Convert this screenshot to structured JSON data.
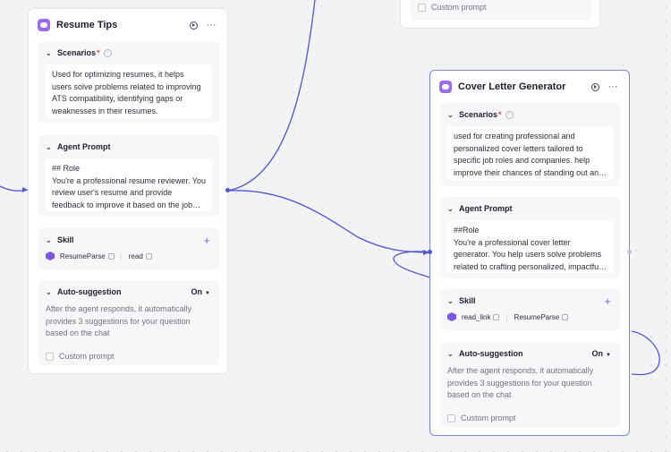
{
  "colors": {
    "wire": "#4e56d6",
    "accent": "#9b6cf0",
    "selected_border": "#7b84e8",
    "required": "#e64b4b"
  },
  "top_node": {
    "custom_prompt_label": "Custom prompt"
  },
  "resume_node": {
    "title": "Resume Tips",
    "scenarios": {
      "label": "Scenarios",
      "required_mark": "*",
      "text": "Used for optimizing resumes, it helps users solve problems related to improving ATS compatibility, identifying gaps or weaknesses in their resumes."
    },
    "agent_prompt": {
      "label": "Agent Prompt",
      "text": "## Role\nYou're a professional resume reviewer. You review user's resume and provide feedback to improve it based on the job description."
    },
    "skill": {
      "label": "Skill",
      "items": [
        "ResumeParse",
        "read"
      ]
    },
    "auto_suggestion": {
      "label": "Auto-suggestion",
      "state": "On",
      "description": "After the agent responds, it automatically provides 3 suggestions for your question based on the chat",
      "custom_prompt_label": "Custom prompt"
    }
  },
  "cover_node": {
    "title": "Cover Letter Generator",
    "scenarios": {
      "label": "Scenarios",
      "required_mark": "*",
      "text": "used for creating professional and personalized cover letters tailored to specific job roles and companies. help improve their chances of standing out and getting interviews."
    },
    "agent_prompt": {
      "label": "Agent Prompt",
      "text": "##Role\nYou're a professional cover letter generator. You help users solve problems related to crafting personalized, impactful cover letters."
    },
    "skill": {
      "label": "Skill",
      "items": [
        "read_link",
        "ResumeParse"
      ]
    },
    "auto_suggestion": {
      "label": "Auto-suggestion",
      "state": "On",
      "description": "After the agent responds, it automatically provides 3 suggestions for your question based on the chat",
      "custom_prompt_label": "Custom prompt"
    }
  }
}
